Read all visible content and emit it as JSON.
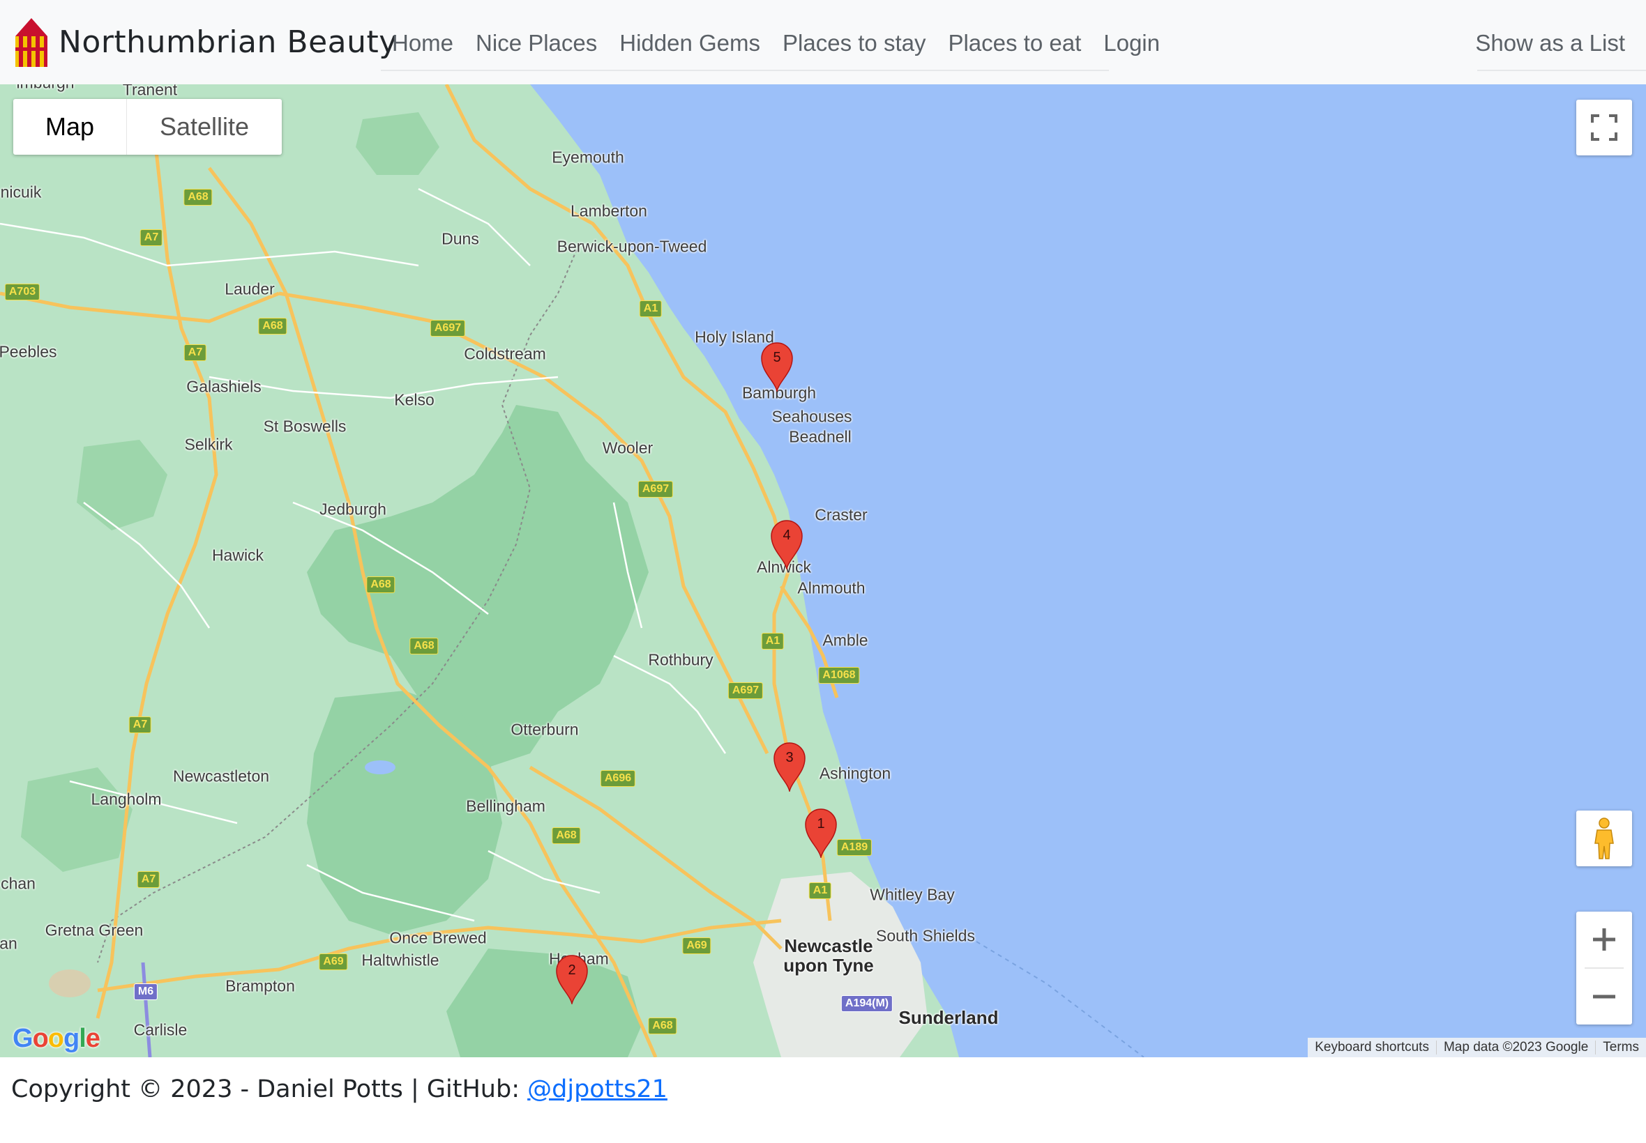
{
  "navbar": {
    "brand": "Northumbrian Beauty",
    "links": [
      "Home",
      "Nice Places",
      "Hidden Gems",
      "Places to stay",
      "Places to eat",
      "Login"
    ],
    "right_link": "Show as a List"
  },
  "map": {
    "type_control": {
      "map_label": "Map",
      "satellite_label": "Satellite",
      "selected": "Map"
    },
    "colors": {
      "land": "#b9e3c5",
      "sea": "#9cc0f9",
      "forest": "#94d2a5",
      "major_road": "#f7c35c",
      "border": "#8a8a8a"
    },
    "places": [
      "Tranent",
      "Eyemouth",
      "Lamberton",
      "Duns",
      "Berwick-upon-Tweed",
      "nicuik",
      "Lauder",
      "Peebles",
      "Coldstream",
      "Holy Island",
      "Bamburgh",
      "Seahouses",
      "Beadnell",
      "Galashiels",
      "Kelso",
      "St Boswells",
      "Selkirk",
      "Wooler",
      "Craster",
      "Jedburgh",
      "Hawick",
      "Alnwick",
      "Alnmouth",
      "Amble",
      "Rothbury",
      "Otterburn",
      "Ashington",
      "Newcastleton",
      "Langholm",
      "Bellingham",
      "Whitley Bay",
      "chan",
      "Gretna Green",
      "Once Brewed",
      "Haltwhistle",
      "South Shields",
      "Hexham",
      "Brampton",
      "Sunderland",
      "Carlisle",
      "an",
      "imburgh"
    ],
    "major_places": [
      "Newcastle upon Tyne"
    ],
    "roads": [
      "A68",
      "A7",
      "A703",
      "A697",
      "A1",
      "A1068",
      "A696",
      "A189",
      "A69",
      "M6",
      "A194(M)"
    ],
    "markers": [
      "1",
      "2",
      "3",
      "4",
      "5"
    ],
    "google_logo": "Google",
    "attribution": {
      "shortcuts": "Keyboard shortcuts",
      "data": "Map data ©2023 Google",
      "terms": "Terms"
    }
  },
  "footer": {
    "text": "Copyright © 2023 - Daniel Potts | GitHub: ",
    "link": "@djpotts21"
  }
}
